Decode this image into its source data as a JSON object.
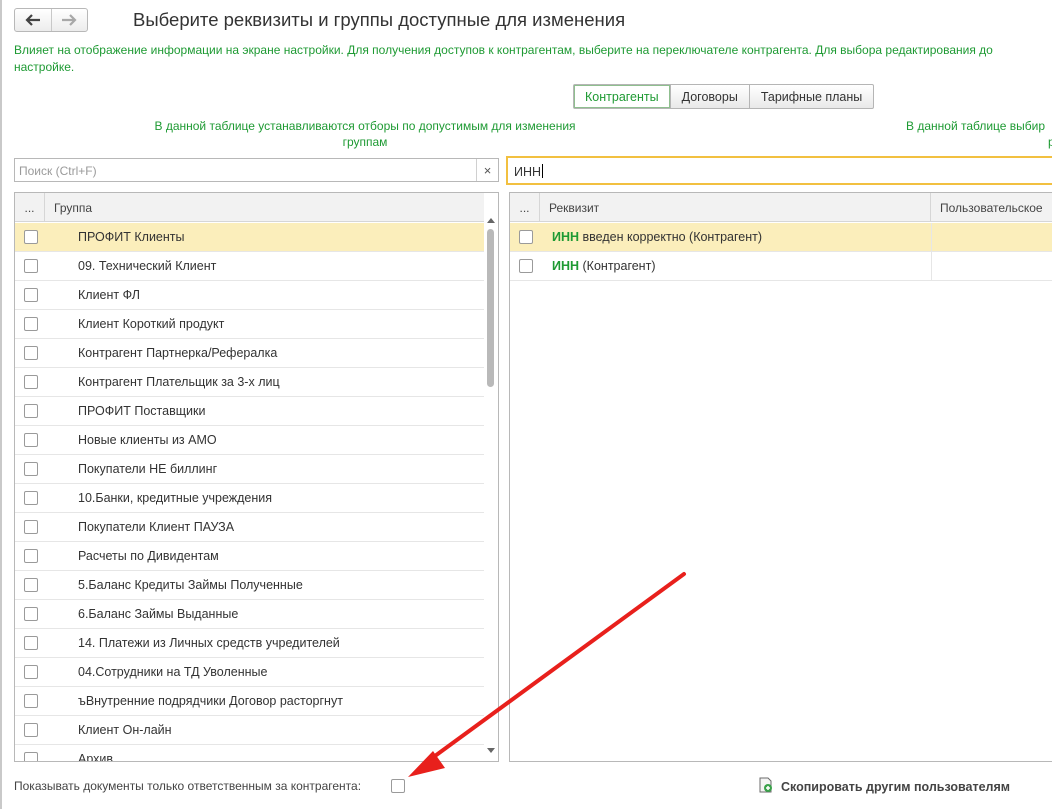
{
  "header": {
    "title": "Выберите реквизиты и группы доступные для изменения",
    "back_icon": "arrow-left-icon",
    "forward_icon": "arrow-right-icon"
  },
  "info": {
    "line1": "Влияет на отображение информации на экране настройки. Для получения доступов к контрагентам, выберите на переключателе контрагента. Для выбора редактирования до",
    "line2": "настройке."
  },
  "tabs": [
    {
      "label": "Контрагенты",
      "active": true
    },
    {
      "label": "Договоры",
      "active": false
    },
    {
      "label": "Тарифные планы",
      "active": false
    }
  ],
  "notes": {
    "left": "В данной таблице устанавливаются отборы по допустимым для изменения группам",
    "right_line1": "В данной таблице выбир",
    "right_line2": "р"
  },
  "left_panel": {
    "search_placeholder": "Поиск (Ctrl+F)",
    "clear_symbol": "×",
    "columns": {
      "dots": "...",
      "group": "Группа"
    },
    "rows": [
      {
        "label": "ПРОФИТ Клиенты",
        "checked": false,
        "selected": true
      },
      {
        "label": "09. Технический Клиент",
        "checked": false
      },
      {
        "label": "Клиент ФЛ",
        "checked": false
      },
      {
        "label": "Клиент Короткий продукт",
        "checked": false
      },
      {
        "label": "Контрагент Партнерка/Рефералка",
        "checked": false
      },
      {
        "label": "Контрагент Плательщик за 3-х лиц",
        "checked": false
      },
      {
        "label": "ПРОФИТ Поставщики",
        "checked": false
      },
      {
        "label": "Новые клиенты из АМО",
        "checked": false
      },
      {
        "label": "Покупатели НЕ биллинг",
        "checked": false
      },
      {
        "label": "10.Банки, кредитные учреждения",
        "checked": false
      },
      {
        "label": "Покупатели Клиент ПАУЗА",
        "checked": false
      },
      {
        "label": "Расчеты по Дивидентам",
        "checked": false
      },
      {
        "label": "5.Баланс Кредиты Займы Полученные",
        "checked": false
      },
      {
        "label": "6.Баланс Займы Выданные",
        "checked": false
      },
      {
        "label": "14. Платежи из Личных средств учредителей",
        "checked": false
      },
      {
        "label": "04.Сотрудники на ТД Уволенные",
        "checked": false
      },
      {
        "label": "ъВнутренние подрядчики Договор расторгнут",
        "checked": false
      },
      {
        "label": "Клиент Он-лайн",
        "checked": false
      },
      {
        "label": "Архив",
        "checked": false
      }
    ]
  },
  "right_panel": {
    "search_value": "ИНН",
    "columns": {
      "dots": "...",
      "attribute": "Реквизит",
      "custom": "Пользовательское"
    },
    "rows": [
      {
        "highlight": "ИНН",
        "rest": " введен корректно (Контрагент)",
        "checked": false,
        "selected": true
      },
      {
        "highlight": "ИНН",
        "rest": " (Контрагент)",
        "checked": false,
        "selected": false
      }
    ]
  },
  "footer": {
    "show_docs_label": "Показывать документы только ответственным за контрагента:",
    "show_docs_checked": false,
    "copy_button": "Скопировать другим пользователям",
    "copy_icon": "copy-users-icon"
  },
  "colors": {
    "accent_green": "#1e9a33",
    "selection": "#fbeebb",
    "search_focus": "#f2c040",
    "annotation_arrow": "#e8201c"
  }
}
